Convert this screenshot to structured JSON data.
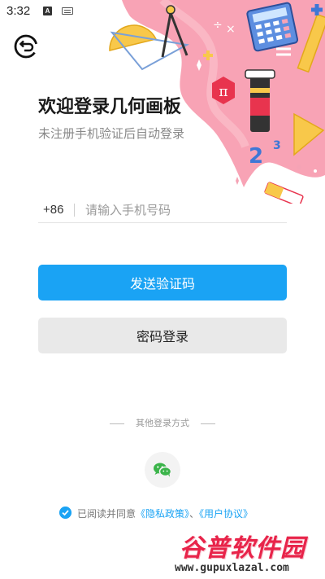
{
  "status_bar": {
    "time": "3:32",
    "notification_icons": [
      "a-badge-icon",
      "keyboard-icon"
    ],
    "system_icons": [
      "wifi-icon",
      "signal-icon",
      "battery-icon"
    ]
  },
  "header": {
    "back_icon": "back-icon",
    "title": "欢迎登录几何画板",
    "subtitle": "未注册手机验证后自动登录"
  },
  "phone": {
    "country_code": "+86",
    "placeholder": "请输入手机号码",
    "value": ""
  },
  "buttons": {
    "send_code": "发送验证码",
    "password_login": "密码登录"
  },
  "other_login": {
    "label": "其他登录方式",
    "wechat_icon": "wechat-icon"
  },
  "agreement": {
    "checked": true,
    "prefix": "已阅读并同意",
    "privacy_link": "《隐私政策》",
    "separator": "、",
    "user_link": "《用户协议》"
  },
  "watermark": {
    "brand": "谷普软件园",
    "url": "www.gupuxlazal.com"
  },
  "colors": {
    "accent": "#1aa3f4",
    "secondary_button": "#e9e9e9",
    "decoration_pink": "#f8a3b5",
    "watermark_red": "#e8244a"
  }
}
